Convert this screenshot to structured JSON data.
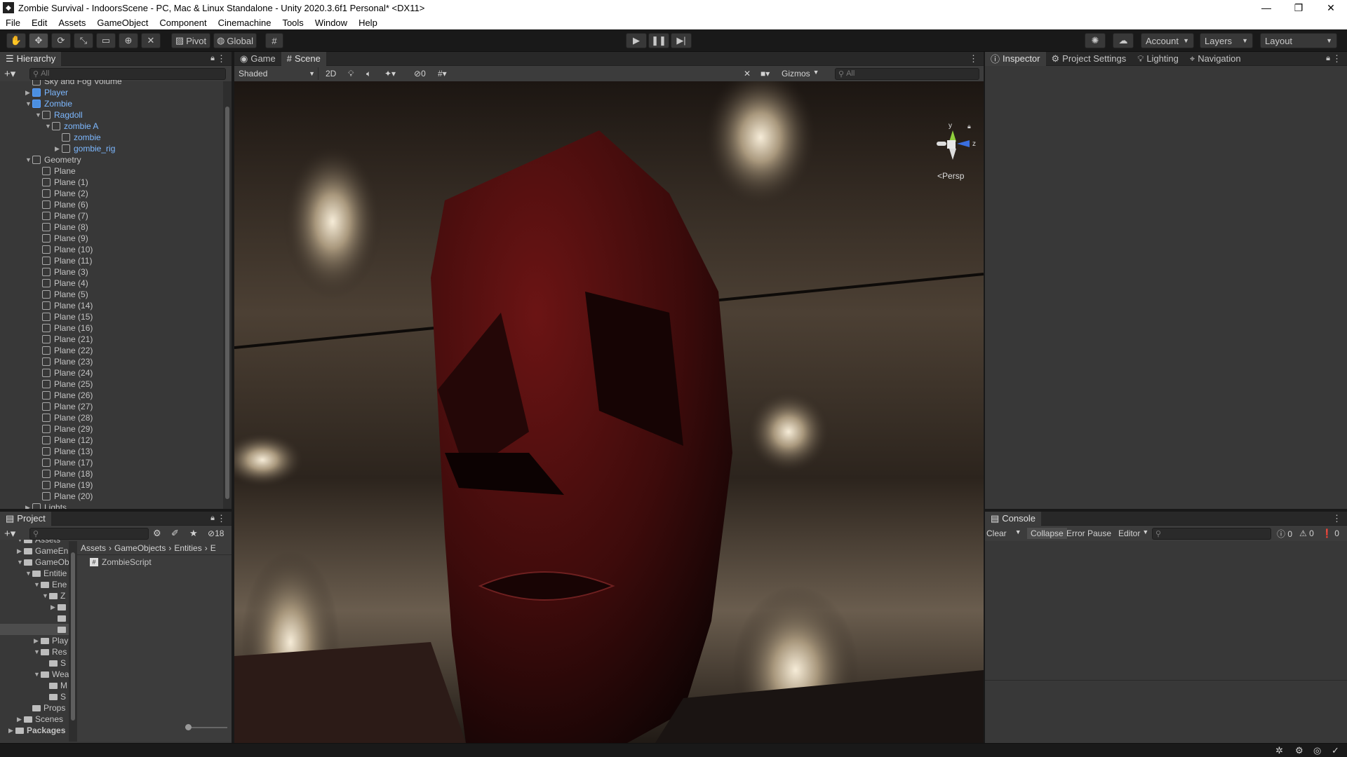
{
  "window": {
    "title": "Zombie Survival - IndoorsScene - PC, Mac & Linux Standalone - Unity 2020.3.6f1 Personal* <DX11>",
    "controls": [
      "—",
      "❐",
      "✕"
    ]
  },
  "menu": [
    "File",
    "Edit",
    "Assets",
    "GameObject",
    "Component",
    "Cinemachine",
    "Tools",
    "Window",
    "Help"
  ],
  "toolbar": {
    "pivot": "Pivot",
    "global": "Global",
    "account": "Account",
    "layers": "Layers",
    "layout": "Layout"
  },
  "hierarchy": {
    "tab": "Hierarchy",
    "search_placeholder": "All",
    "items": [
      {
        "label": "Sky and Fog Volume",
        "indent": 1,
        "arrow": "",
        "blue": false
      },
      {
        "label": "Player",
        "indent": 1,
        "arrow": "▶",
        "blue": true,
        "prefab": true
      },
      {
        "label": "Zombie",
        "indent": 1,
        "arrow": "▼",
        "blue": true,
        "prefab": true
      },
      {
        "label": "Ragdoll",
        "indent": 2,
        "arrow": "▼",
        "blue": true
      },
      {
        "label": "zombie A",
        "indent": 3,
        "arrow": "▼",
        "blue": true
      },
      {
        "label": "zombie",
        "indent": 4,
        "arrow": "",
        "blue": true
      },
      {
        "label": "gombie_rig",
        "indent": 4,
        "arrow": "▶",
        "blue": true
      },
      {
        "label": "Geometry",
        "indent": 1,
        "arrow": "▼",
        "blue": false
      },
      {
        "label": "Plane",
        "indent": 2,
        "arrow": "",
        "blue": false
      },
      {
        "label": "Plane (1)",
        "indent": 2,
        "arrow": "",
        "blue": false
      },
      {
        "label": "Plane (2)",
        "indent": 2,
        "arrow": "",
        "blue": false
      },
      {
        "label": "Plane (6)",
        "indent": 2,
        "arrow": "",
        "blue": false
      },
      {
        "label": "Plane (7)",
        "indent": 2,
        "arrow": "",
        "blue": false
      },
      {
        "label": "Plane (8)",
        "indent": 2,
        "arrow": "",
        "blue": false
      },
      {
        "label": "Plane (9)",
        "indent": 2,
        "arrow": "",
        "blue": false
      },
      {
        "label": "Plane (10)",
        "indent": 2,
        "arrow": "",
        "blue": false
      },
      {
        "label": "Plane (11)",
        "indent": 2,
        "arrow": "",
        "blue": false
      },
      {
        "label": "Plane (3)",
        "indent": 2,
        "arrow": "",
        "blue": false
      },
      {
        "label": "Plane (4)",
        "indent": 2,
        "arrow": "",
        "blue": false
      },
      {
        "label": "Plane (5)",
        "indent": 2,
        "arrow": "",
        "blue": false
      },
      {
        "label": "Plane (14)",
        "indent": 2,
        "arrow": "",
        "blue": false
      },
      {
        "label": "Plane (15)",
        "indent": 2,
        "arrow": "",
        "blue": false
      },
      {
        "label": "Plane (16)",
        "indent": 2,
        "arrow": "",
        "blue": false
      },
      {
        "label": "Plane (21)",
        "indent": 2,
        "arrow": "",
        "blue": false
      },
      {
        "label": "Plane (22)",
        "indent": 2,
        "arrow": "",
        "blue": false
      },
      {
        "label": "Plane (23)",
        "indent": 2,
        "arrow": "",
        "blue": false
      },
      {
        "label": "Plane (24)",
        "indent": 2,
        "arrow": "",
        "blue": false
      },
      {
        "label": "Plane (25)",
        "indent": 2,
        "arrow": "",
        "blue": false
      },
      {
        "label": "Plane (26)",
        "indent": 2,
        "arrow": "",
        "blue": false
      },
      {
        "label": "Plane (27)",
        "indent": 2,
        "arrow": "",
        "blue": false
      },
      {
        "label": "Plane (28)",
        "indent": 2,
        "arrow": "",
        "blue": false
      },
      {
        "label": "Plane (29)",
        "indent": 2,
        "arrow": "",
        "blue": false
      },
      {
        "label": "Plane (12)",
        "indent": 2,
        "arrow": "",
        "blue": false
      },
      {
        "label": "Plane (13)",
        "indent": 2,
        "arrow": "",
        "blue": false
      },
      {
        "label": "Plane (17)",
        "indent": 2,
        "arrow": "",
        "blue": false
      },
      {
        "label": "Plane (18)",
        "indent": 2,
        "arrow": "",
        "blue": false
      },
      {
        "label": "Plane (19)",
        "indent": 2,
        "arrow": "",
        "blue": false
      },
      {
        "label": "Plane (20)",
        "indent": 2,
        "arrow": "",
        "blue": false
      },
      {
        "label": "Lights",
        "indent": 1,
        "arrow": "▶",
        "blue": false
      }
    ]
  },
  "scene_view": {
    "tabs": [
      "Game",
      "Scene"
    ],
    "shading": "Shaded",
    "mode_2d": "2D",
    "hidden_count": "0",
    "gizmos": "Gizmos",
    "search_placeholder": "All",
    "persp_label": "Persp",
    "axis_y": "y",
    "axis_z": "z"
  },
  "inspector_tabs": [
    "Inspector",
    "Project Settings",
    "Lighting",
    "Navigation"
  ],
  "project": {
    "tab": "Project",
    "count": "18",
    "breadcrumb": [
      "Assets",
      "GameObjects",
      "Entities",
      "E"
    ],
    "tree": [
      {
        "label": "Assets",
        "indent": 1,
        "arrow": "▼"
      },
      {
        "label": "GameEn",
        "indent": 1,
        "arrow": "▶"
      },
      {
        "label": "GameOb",
        "indent": 1,
        "arrow": "▼"
      },
      {
        "label": "Entitie",
        "indent": 2,
        "arrow": "▼"
      },
      {
        "label": "Ene",
        "indent": 3,
        "arrow": "▼"
      },
      {
        "label": "Z",
        "indent": 4,
        "arrow": "▼"
      },
      {
        "label": "",
        "indent": 5,
        "arrow": "▶"
      },
      {
        "label": "",
        "indent": 5,
        "arrow": ""
      },
      {
        "label": "",
        "indent": 5,
        "arrow": "",
        "selected": true
      },
      {
        "label": "Play",
        "indent": 3,
        "arrow": "▶"
      },
      {
        "label": "Res",
        "indent": 3,
        "arrow": "▼"
      },
      {
        "label": "S",
        "indent": 4,
        "arrow": ""
      },
      {
        "label": "Wea",
        "indent": 3,
        "arrow": "▼"
      },
      {
        "label": "M",
        "indent": 4,
        "arrow": ""
      },
      {
        "label": "S",
        "indent": 4,
        "arrow": ""
      },
      {
        "label": "Props",
        "indent": 2,
        "arrow": ""
      },
      {
        "label": "Scenes",
        "indent": 1,
        "arrow": "▶"
      },
      {
        "label": "Packages",
        "indent": 0,
        "arrow": "▶"
      }
    ],
    "files": [
      {
        "label": "ZombieScript"
      }
    ]
  },
  "console": {
    "tab": "Console",
    "clear": "Clear",
    "collapse": "Collapse",
    "error_pause": "Error Pause",
    "editor": "Editor",
    "info_count": "0",
    "warn_count": "0",
    "error_count": "0"
  },
  "colors": {
    "editor_bg": "#383838",
    "toolbar_bg": "#191919",
    "selection_blue": "#7db8ff"
  }
}
